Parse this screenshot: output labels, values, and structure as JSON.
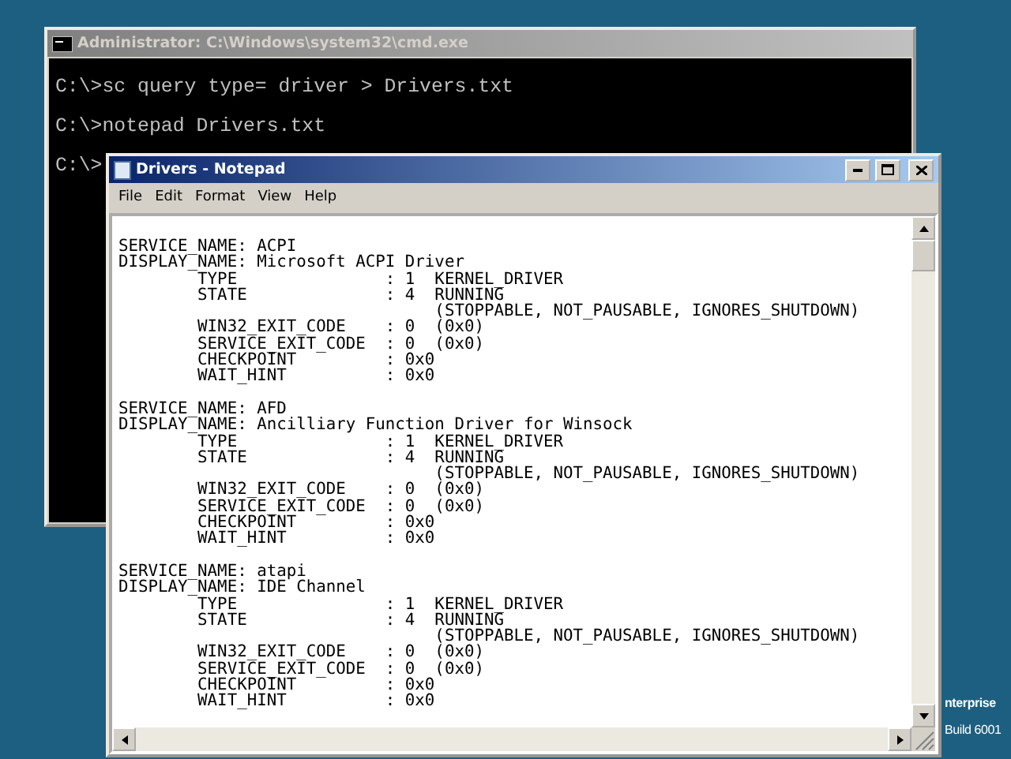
{
  "console_window": {
    "title": "Administrator: C:\\Windows\\system32\\cmd.exe",
    "active": false,
    "lines": [
      "C:\\>sc query type= driver > Drivers.txt",
      "C:\\>notepad Drivers.txt",
      "C:\\>"
    ]
  },
  "notepad_window": {
    "title": "Drivers - Notepad",
    "active": true,
    "menu": [
      "File",
      "Edit",
      "Format",
      "View",
      "Help"
    ],
    "blocks": [
      {
        "lines": [
          "SERVICE_NAME: ACPI",
          "DISPLAY_NAME: Microsoft ACPI Driver",
          "        TYPE               : 1  KERNEL_DRIVER",
          "        STATE              : 4  RUNNING",
          "                                (STOPPABLE, NOT_PAUSABLE, IGNORES_SHUTDOWN)",
          "        WIN32_EXIT_CODE    : 0  (0x0)",
          "        SERVICE_EXIT_CODE  : 0  (0x0)",
          "        CHECKPOINT         : 0x0",
          "        WAIT_HINT          : 0x0"
        ]
      },
      {
        "lines": [
          "SERVICE_NAME: AFD",
          "DISPLAY_NAME: Ancilliary Function Driver for Winsock",
          "        TYPE               : 1  KERNEL_DRIVER",
          "        STATE              : 4  RUNNING",
          "                                (STOPPABLE, NOT_PAUSABLE, IGNORES_SHUTDOWN)",
          "        WIN32_EXIT_CODE    : 0  (0x0)",
          "        SERVICE_EXIT_CODE  : 0  (0x0)",
          "        CHECKPOINT         : 0x0",
          "        WAIT_HINT          : 0x0"
        ]
      },
      {
        "lines": [
          "SERVICE_NAME: atapi",
          "DISPLAY_NAME: IDE Channel",
          "        TYPE               : 1  KERNEL_DRIVER",
          "        STATE              : 4  RUNNING",
          "                                (STOPPABLE, NOT_PAUSABLE, IGNORES_SHUTDOWN)",
          "        WIN32_EXIT_CODE    : 0  (0x0)",
          "        SERVICE_EXIT_CODE  : 0  (0x0)",
          "        CHECKPOINT         : 0x0",
          "        WAIT_HINT          : 0x0"
        ]
      }
    ]
  },
  "desktop_text": [
    "nterprise",
    "Build 6001"
  ]
}
